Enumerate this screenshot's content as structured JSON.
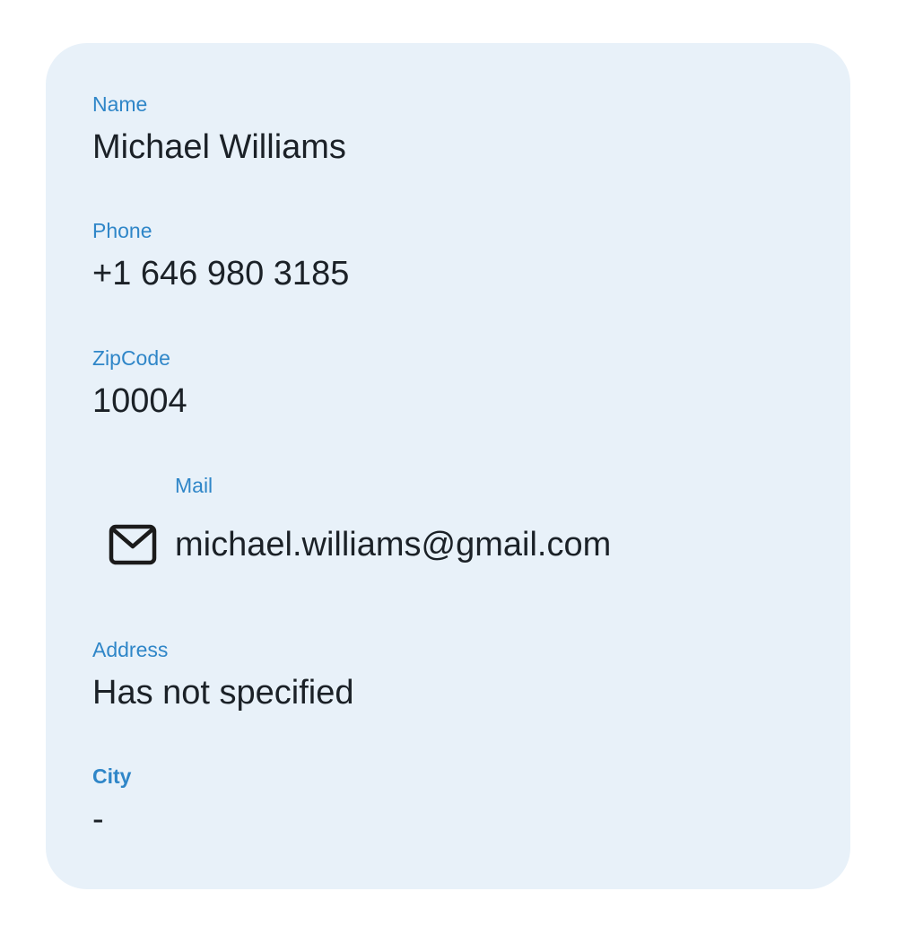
{
  "contact": {
    "name": {
      "label": "Name",
      "value": "Michael Williams"
    },
    "phone": {
      "label": "Phone",
      "value": "+1 646 980 3185"
    },
    "zipcode": {
      "label": "ZipCode",
      "value": "10004"
    },
    "mail": {
      "label": "Mail",
      "value": "michael.williams@gmail.com",
      "icon": "mail-icon"
    },
    "address": {
      "label": "Address",
      "value": "Has not specified"
    },
    "city": {
      "label": "City",
      "value": "-"
    }
  },
  "colors": {
    "card_background": "#e8f1f9",
    "label": "#2f86c8",
    "value": "#1b2127"
  }
}
